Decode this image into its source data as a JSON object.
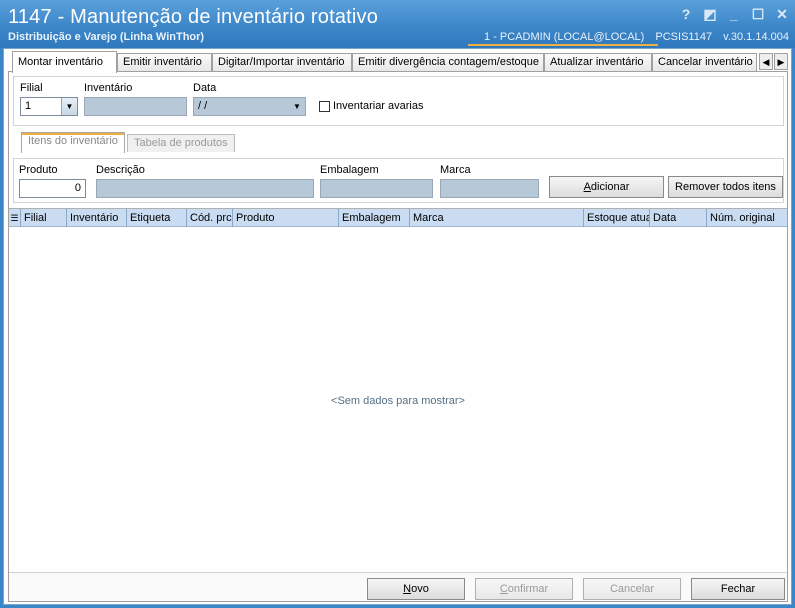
{
  "window": {
    "title": "1147 - Manutenção de inventário rotativo",
    "subtitle": "Distribuição e Varejo (Linha WinThor)",
    "user_info": "1 - PCADMIN (LOCAL@LOCAL)",
    "program": "PCSIS1147",
    "version": "v.30.1.14.004",
    "buttons": {
      "help": "?",
      "restore": "◩",
      "minimize": "_",
      "maximize": "☐",
      "close": "✕"
    }
  },
  "tabs": [
    {
      "label": "Montar inventário",
      "active": true
    },
    {
      "label": "Emitir inventário"
    },
    {
      "label": "Digitar/Importar inventário"
    },
    {
      "label": "Emitir divergência contagem/estoque"
    },
    {
      "label": "Atualizar inventário"
    },
    {
      "label": "Cancelar inventário"
    }
  ],
  "filters": {
    "filial_label": "Filial",
    "filial_value": "1",
    "inventario_label": "Inventário",
    "inventario_value": "",
    "data_label": "Data",
    "data_value": " / /",
    "avarias_label": "Inventariar avarias",
    "avarias_checked": false
  },
  "inner_tabs": [
    {
      "label": "Itens do inventário",
      "active": true
    },
    {
      "label": "Tabela de produtos"
    }
  ],
  "items": {
    "produto_label": "Produto",
    "produto_value": "0",
    "descricao_label": "Descrição",
    "embalagem_label": "Embalagem",
    "marca_label": "Marca",
    "add_button": "Adicionar",
    "remove_all_button": "Remover todos itens"
  },
  "grid": {
    "columns": [
      "Filial",
      "Inventário",
      "Etiqueta",
      "Cód. prc",
      "Produto",
      "Embalagem",
      "Marca",
      "Estoque atua",
      "Data",
      "Núm. original"
    ],
    "empty_message": "<Sem dados para mostrar>"
  },
  "footer": {
    "novo": "Novo",
    "confirmar": "Confirmar",
    "cancelar": "Cancelar",
    "fechar": "Fechar"
  }
}
